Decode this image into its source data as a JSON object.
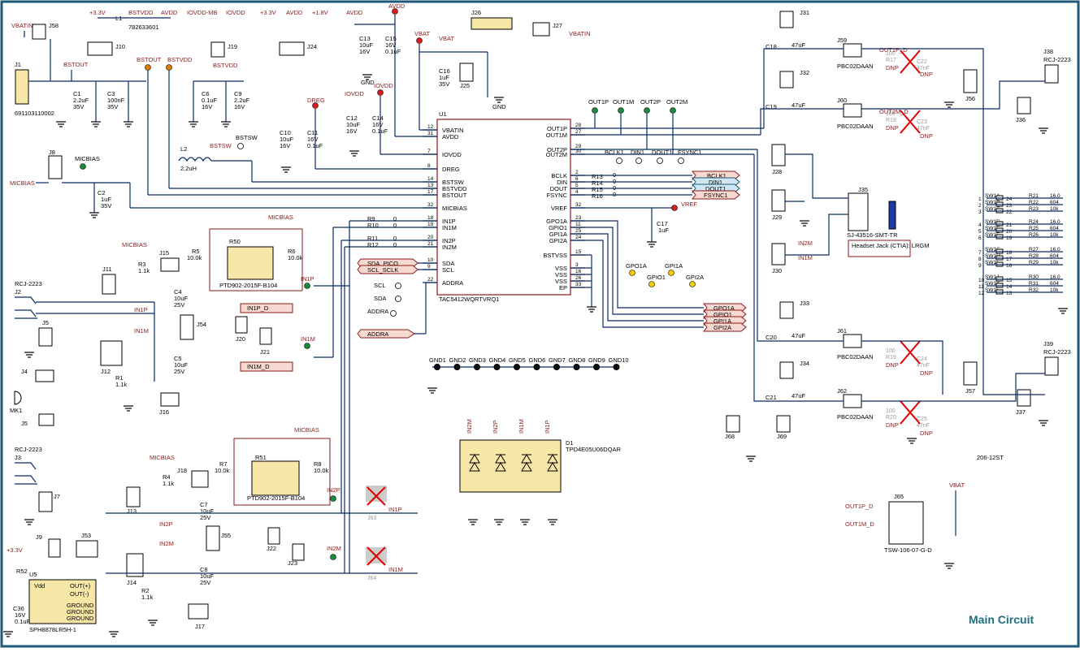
{
  "sheet": {
    "title": "Main Circuit",
    "border_color": "#1e5a78",
    "title_color": "#1e6e82"
  },
  "u1": {
    "ref": "U1",
    "part": "TAC5412WQRTVRQ1",
    "left_pins": [
      {
        "num": "12",
        "name": "VBATIN"
      },
      {
        "num": "31",
        "name": "AVDD"
      },
      {
        "num": "7",
        "name": "IOVDD"
      },
      {
        "num": "8",
        "name": "DREG"
      },
      {
        "num": "14",
        "name": "BSTSW"
      },
      {
        "num": "13",
        "name": "BSTVDD"
      },
      {
        "num": "17",
        "name": "BSTOUT"
      },
      {
        "num": "32",
        "name": "MICBIAS"
      },
      {
        "num": "18",
        "name": "IN1P"
      },
      {
        "num": "19",
        "name": "IN1M"
      },
      {
        "num": "20",
        "name": "IN2P"
      },
      {
        "num": "21",
        "name": "IN2M"
      },
      {
        "num": "10",
        "name": "SDA"
      },
      {
        "num": "9",
        "name": "SCL"
      },
      {
        "num": "22",
        "name": "ADDRA"
      }
    ],
    "right_pins": [
      {
        "num": "28",
        "name": "OUT1P"
      },
      {
        "num": "27",
        "name": "OUT1M"
      },
      {
        "num": "29",
        "name": "OUT2P"
      },
      {
        "num": "30",
        "name": "OUT2M"
      },
      {
        "num": "2",
        "name": "BCLK"
      },
      {
        "num": "6",
        "name": "DIN"
      },
      {
        "num": "5",
        "name": "DOUT"
      },
      {
        "num": "4",
        "name": "FSYNC"
      },
      {
        "num": "32",
        "name": "VREF"
      },
      {
        "num": "23",
        "name": "GPO1A"
      },
      {
        "num": "11",
        "name": "GPIO1"
      },
      {
        "num": "25",
        "name": "GPI1A"
      },
      {
        "num": "24",
        "name": "GPI2A"
      },
      {
        "num": "15",
        "name": "BSTVSS"
      },
      {
        "num": "3",
        "name": "VSS"
      },
      {
        "num": "16",
        "name": "VSS"
      },
      {
        "num": "26",
        "name": "VSS"
      },
      {
        "num": "33",
        "name": "EP"
      }
    ]
  },
  "power_rails": {
    "vbatin": "VBATIN",
    "v33": "+3.3V",
    "bstvdd": "BSTVDD",
    "avdd": "AVDD",
    "iovdd_mb": "IOVDD-MB",
    "iovdd": "IOVDD",
    "v18": "+1.8V",
    "vbat": "VBAT",
    "bstout": "BSTOUT",
    "micbias": "MICBIAS",
    "dreg": "DREG",
    "bstsw": "BSTSW"
  },
  "power_parts": {
    "j58": "J58",
    "j1": "J1",
    "j1_part": "691103110002",
    "l1": "L1",
    "l1_part": "782633601",
    "j10": "J10",
    "j19": "J19",
    "j24": "J24",
    "j26": "J26",
    "j27": "J27",
    "j25": "J25",
    "c1": "C1",
    "c1_val": "2.2uF",
    "c1_v": "35V",
    "c3": "C3",
    "c3_val": "100nF",
    "c3_v": "35V",
    "c6": "C6",
    "c6_val": "0.1uF",
    "c6_v": "16V",
    "c9": "C9",
    "c9_val": "2.2uF",
    "c9_v": "16V",
    "c13": "C13",
    "c13_val": "10uF",
    "c13_v": "16V",
    "c15": "C15",
    "c15_val": "16V",
    "c15_v": "0.1uF",
    "c16": "C16",
    "c16_val": "1uF",
    "c16_v": "35V",
    "c10": "C10",
    "c10_val": "10uF",
    "c10_v": "16V",
    "c11": "C11",
    "c11_val": "16V",
    "c11_v": "0.1uF",
    "c12": "C12",
    "c12_val": "10uF",
    "c12_v": "16V",
    "c14": "C14",
    "c14_val": "16V",
    "c14_v": "0.1uF",
    "l2": "L2",
    "l2_val": "2.2uH",
    "j8": "J8",
    "c2": "C2",
    "c2_val": "1uF",
    "c2_v": "35V",
    "gnd": "GND"
  },
  "input_parts": {
    "j2": "J2",
    "j2_part": "RCJ-2223",
    "j3": "J3",
    "j3_part": "RCJ-2223",
    "j5": "J5",
    "j4": "J4",
    "mk1": "MK1",
    "j5b": "J5",
    "j11": "J11",
    "j12": "J12",
    "j15": "J15",
    "j54": "J54",
    "j16": "J16",
    "j20": "J20",
    "j21": "J21",
    "r3": "R3",
    "r3_val": "1.1k",
    "r1": "R1",
    "r1_val": "1.1k",
    "r5": "R5",
    "r5_val": "10.0k",
    "r6": "R6",
    "r6_val": "10.0k",
    "r50": "R50",
    "r50_part": "PTD902-2015F-B104",
    "c4": "C4",
    "c4_val": "10uF",
    "c4_v": "25V",
    "c5": "C5",
    "c5_val": "10uF",
    "c5_v": "25V",
    "in1p": "IN1P",
    "in1m": "IN1M",
    "in1p_d": "IN1P_D",
    "in1m_d": "IN1M_D",
    "j7": "J7",
    "j9": "J9",
    "j53": "J53",
    "j13": "J13",
    "j14": "J14",
    "j18": "J18",
    "j55": "J55",
    "j17": "J17",
    "j22": "J22",
    "j23": "J23",
    "r4": "R4",
    "r4_val": "1.1k",
    "r2": "R2",
    "r2_val": "1.1k",
    "r7": "R7",
    "r7_val": "10.0k",
    "r8": "R8",
    "r8_val": "10.0k",
    "r51": "R51",
    "r51_part": "PTD902-2015F-B104",
    "c7": "C7",
    "c7_val": "10uF",
    "c7_v": "25V",
    "c8": "C8",
    "c8_val": "10uF",
    "c8_v": "25V",
    "in2p": "IN2P",
    "in2m": "IN2M",
    "j63": "J63",
    "j64": "J64",
    "r52": "R52",
    "u5": "U5",
    "u5_part": "SPH8878LR5H-1",
    "u5_vdd": "Vdd",
    "u5_outp": "OUT(+)",
    "u5_outm": "OUT(-)",
    "u5_gnd": "GROUND",
    "c36": "C36",
    "c36_val": "16V",
    "c36_v": "0.1uF"
  },
  "digital": {
    "r9": "R9",
    "r10": "R10",
    "r11": "R11",
    "r12": "R12",
    "r_zero": "0",
    "sda_pico": "SDA_PICO",
    "scl_sclk": "SCL_SCLK",
    "scl": "SCL",
    "sda": "SDA",
    "addra": "ADDRA",
    "r13": "R13",
    "r14": "R14",
    "r15": "R15",
    "r16": "R16",
    "bclk1": "BCLK1",
    "din1": "DIN1",
    "dout1": "DOUT1",
    "fsync1": "FSYNC1",
    "bclk_tp": "BCLK1",
    "din_tp": "DIN1",
    "dout_tp": "DOUT1",
    "fsync_tp": "FSYNC1",
    "vref": "VREF",
    "c17": "C17",
    "c17_val": "1uF",
    "gpo1a_tp": "GPO1A",
    "gpio1_tp": "GPIO1",
    "gpi1a_tp": "GPI1A",
    "gpi2a_tp": "GPI2A",
    "gpo1a": "GPO1A",
    "gpio1": "GPIO1",
    "gpi1a": "GPI1A",
    "gpi2a": "GPI2A",
    "out1p": "OUT1P",
    "out1m": "OUT1M",
    "out2p": "OUT2P",
    "out2m": "OUT2M",
    "d1": "D1",
    "d1_part": "TPD4E05U06DQAR",
    "gnd_tps": [
      "GND1",
      "GND2",
      "GND3",
      "GND4",
      "GND5",
      "GND6",
      "GND7",
      "GND8",
      "GND9",
      "GND10"
    ]
  },
  "output": {
    "j31": "J31",
    "j32": "J32",
    "j33": "J33",
    "j34": "J34",
    "c18": "C18",
    "c19": "C19",
    "c20": "C20",
    "c21": "C21",
    "cap_val": "47uF",
    "j59": "J59",
    "j60": "J60",
    "j61": "J61",
    "j62": "J62",
    "hdr_part": "PBC02DAAN",
    "r17": "R17",
    "r18": "R18",
    "r19": "R19",
    "r20": "R20",
    "c22": "C22",
    "c23": "C23",
    "c24": "C24",
    "c25": "C25",
    "dnp": "DNP",
    "r_dnp_val": "100",
    "c_dnp_val": "47nF",
    "out1p_d": "OUT1P_D",
    "out2m_d": "OUT2M_D",
    "j28": "J28",
    "j29": "J29",
    "j30": "J30",
    "j35": "J35",
    "j35_part": "SJ-43516-SMT-TR",
    "headset_note": "Headset Jack (CTIA):\nLRGM",
    "j56": "J56",
    "j57": "J57",
    "j36": "J36",
    "j37": "J37",
    "j38": "J38",
    "j38_part": "RCJ-2223",
    "j39": "J39",
    "j39_part": "RCJ-2223",
    "j68": "J68",
    "j69": "J69",
    "j65": "J65",
    "j65_part": "TSW-106-07-G-D",
    "j65_out1p": "OUT1P_D",
    "j65_out1m": "OUT1M_D",
    "j65_vbat": "VBAT",
    "sw_part": "206-12ST",
    "sw_rows": [
      {
        "sw": "SW1A",
        "pin": "1",
        "pin2": "24",
        "r": "R21",
        "val": "16.0"
      },
      {
        "sw": "SW1B",
        "pin": "2",
        "pin2": "23",
        "r": "R22",
        "val": "604"
      },
      {
        "sw": "SW1C",
        "pin": "3",
        "pin2": "22",
        "r": "R23",
        "val": "10k"
      },
      {
        "sw": "SW1D",
        "pin": "4",
        "pin2": "21",
        "r": "R24",
        "val": "16.0"
      },
      {
        "sw": "SW1E",
        "pin": "5",
        "pin2": "20",
        "r": "R25",
        "val": "604"
      },
      {
        "sw": "SW1F",
        "pin": "6",
        "pin2": "19",
        "r": "R26",
        "val": "10k"
      },
      {
        "sw": "SW1G",
        "pin": "7",
        "pin2": "18",
        "r": "R27",
        "val": "16.0"
      },
      {
        "sw": "SW1H",
        "pin": "8",
        "pin2": "17",
        "r": "R28",
        "val": "604"
      },
      {
        "sw": "SW1I",
        "pin": "9",
        "pin2": "16",
        "r": "R29",
        "val": "10k"
      },
      {
        "sw": "SW1J",
        "pin": "10",
        "pin2": "15",
        "r": "R30",
        "val": "16.0"
      },
      {
        "sw": "SW1K",
        "pin": "11",
        "pin2": "14",
        "r": "R31",
        "val": "604"
      },
      {
        "sw": "SW1L",
        "pin": "12",
        "pin2": "13",
        "r": "R32",
        "val": "10k"
      }
    ]
  }
}
